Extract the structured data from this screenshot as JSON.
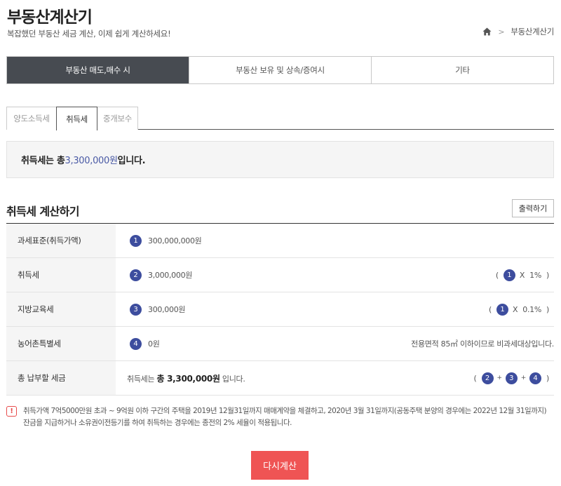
{
  "header": {
    "title": "부동산계산기",
    "subtitle": "복잡했던 부동산 세금 계산, 이제 쉽게 계산하세요!",
    "breadcrumb": {
      "current": "부동산계산기"
    }
  },
  "main_tabs": [
    {
      "label": "부동산 매도,매수 시",
      "active": true
    },
    {
      "label": "부동산 보유 및 상속/증여시",
      "active": false
    },
    {
      "label": "기타",
      "active": false
    }
  ],
  "sub_tabs": [
    {
      "label": "양도소득세",
      "active": false
    },
    {
      "label": "취득세",
      "active": true
    },
    {
      "label": "중개보수",
      "active": false
    }
  ],
  "result": {
    "prefix": "취득세는 총 ",
    "amount": "3,300,000원",
    "suffix": " 입니다."
  },
  "section": {
    "title": "취득세 계산하기",
    "print_label": "출력하기"
  },
  "rows": [
    {
      "label": "과세표준(취득가액)",
      "num": "1",
      "value": "300,000,000원"
    },
    {
      "label": "취득세",
      "num": "2",
      "value": "3,000,000원",
      "formula": {
        "ref": "1",
        "op": "X",
        "rate": "1%"
      }
    },
    {
      "label": "지방교육세",
      "num": "3",
      "value": "300,000원",
      "formula": {
        "ref": "1",
        "op": "X",
        "rate": "0.1%"
      }
    },
    {
      "label": "농어촌특별세",
      "num": "4",
      "value": "0원",
      "note": "전용면적 85㎡ 이하이므로 비과세대상입니다."
    }
  ],
  "total": {
    "label": "총 납부할 세금",
    "prefix": "취득세는 ",
    "amount": "총 3,300,000원",
    "suffix": " 입니다.",
    "refs": [
      "2",
      "3",
      "4"
    ],
    "op": "+"
  },
  "notice": {
    "icon": "!",
    "text": "취득가액 7억5000만원 초과 ~ 9억원 이하 구간의 주택을 2019년 12월31일까지 매매계약을 체결하고, 2020년 3월 31일까지(공동주택 분양의 경우에는 2022년 12월 31일까지) 잔금을 지급하거나 소유권이전등기를 하여 취득하는 경우에는 종전의 2% 세율이 적용됩니다."
  },
  "recalc_label": "다시계산",
  "colors": {
    "active_tab_bg": "#474b51",
    "circle_bg": "#3d4d9e",
    "amount_text": "#4a5aa5",
    "recalc_bg": "#ef5454",
    "warn": "#e74c4c"
  },
  "icons": {
    "breadcrumb_home": "home-icon",
    "breadcrumb_separator": "chevron-right-icon"
  }
}
